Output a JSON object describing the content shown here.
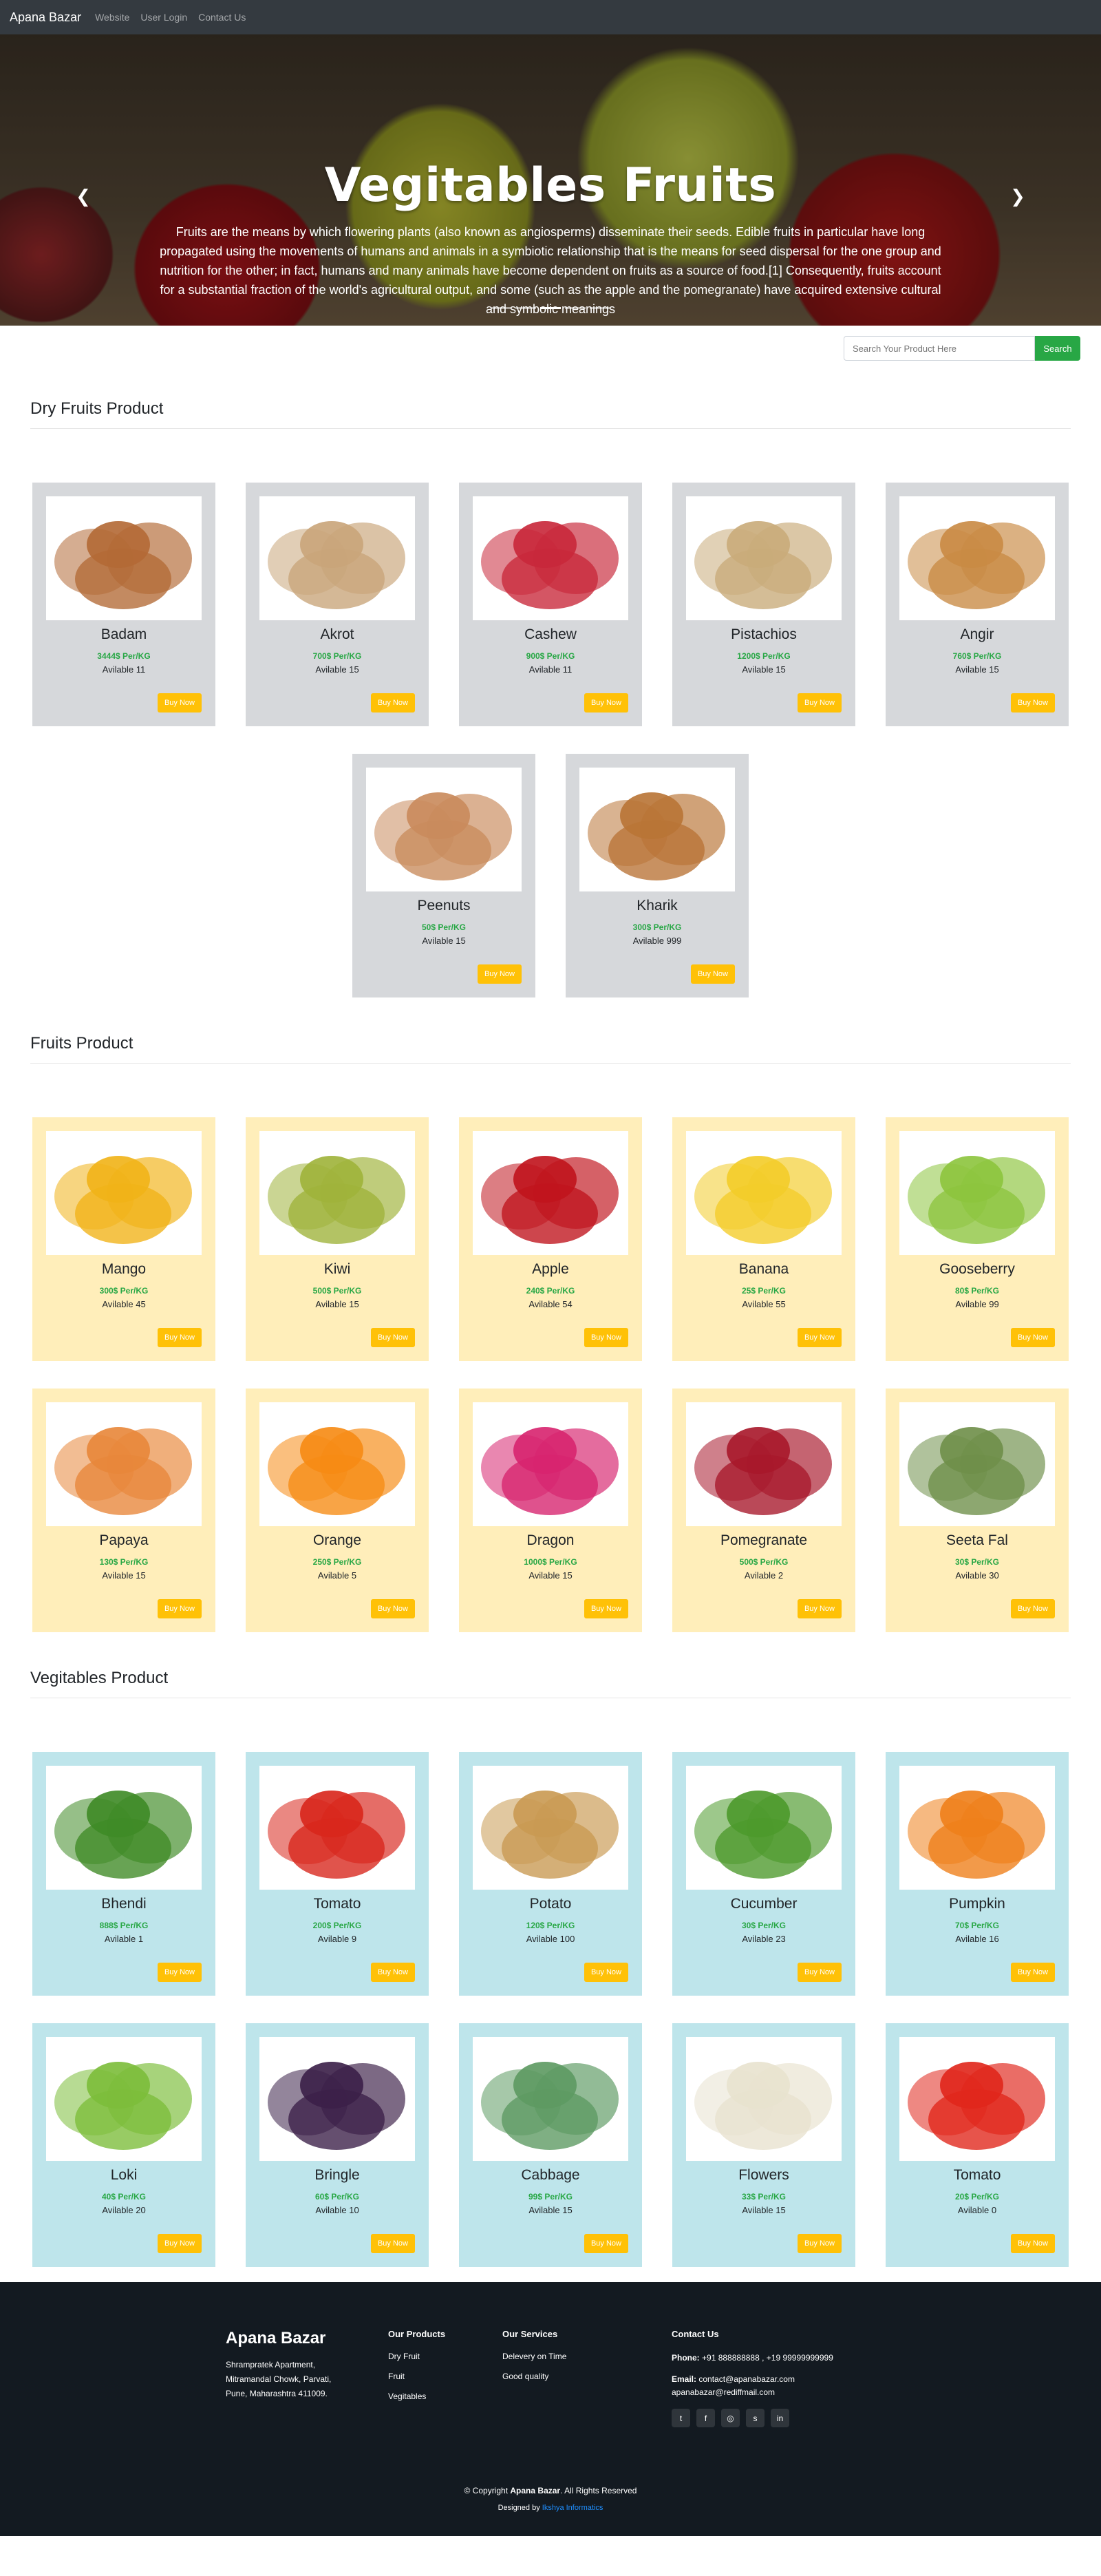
{
  "navbar": {
    "brand": "Apana Bazar",
    "links": [
      "Website",
      "User Login",
      "Contact Us"
    ]
  },
  "hero": {
    "title": "Vegitables Fruits",
    "text": "Fruits are the means by which flowering plants (also known as angiosperms) disseminate their seeds. Edible fruits in particular have long propagated using the movements of humans and animals in a symbiotic relationship that is the means for seed dispersal for the one group and nutrition for the other; in fact, humans and many animals have become dependent on fruits as a source of food.[1] Consequently, fruits account for a substantial fraction of the world's agricultural output, and some (such as the apple and the pomegranate) have acquired extensive cultural and symbolic meanings",
    "prev_icon": "chevron-left-icon",
    "next_icon": "chevron-right-icon",
    "active_slide": 3,
    "slide_count": 5
  },
  "search": {
    "placeholder": "Search Your Product Here",
    "button": "Search"
  },
  "buy_label": "Buy Now",
  "sections": [
    {
      "title": "Dry Fruits Product",
      "products": [
        {
          "name": "Badam",
          "price": "3444$ Per/KG",
          "avail": "Avilable 11",
          "color": "#b36a36"
        },
        {
          "name": "Akrot",
          "price": "700$ Per/KG",
          "avail": "Avilable 15",
          "color": "#c9a57a"
        },
        {
          "name": "Cashew",
          "price": "900$ Per/KG",
          "avail": "Avilable 11",
          "color": "#c8283a"
        },
        {
          "name": "Pistachios",
          "price": "1200$ Per/KG",
          "avail": "Avilable 15",
          "color": "#c9ab7a"
        },
        {
          "name": "Angir",
          "price": "760$ Per/KG",
          "avail": "Avilable 15",
          "color": "#c98a44"
        },
        {
          "name": "Peenuts",
          "price": "50$ Per/KG",
          "avail": "Avilable 15",
          "color": "#c98b5c"
        },
        {
          "name": "Kharik",
          "price": "300$ Per/KG",
          "avail": "Avilable 999",
          "color": "#b97436"
        }
      ]
    },
    {
      "title": "Fruits Product",
      "products": [
        {
          "name": "Mango",
          "price": "300$ Per/KG",
          "avail": "Avilable 45",
          "color": "#f1b318"
        },
        {
          "name": "Kiwi",
          "price": "500$ Per/KG",
          "avail": "Avilable 15",
          "color": "#9fb33a"
        },
        {
          "name": "Apple",
          "price": "240$ Per/KG",
          "avail": "Avilable 54",
          "color": "#c0141d"
        },
        {
          "name": "Banana",
          "price": "25$ Per/KG",
          "avail": "Avilable 55",
          "color": "#f3cc2a"
        },
        {
          "name": "Gooseberry",
          "price": "80$ Per/KG",
          "avail": "Avilable 99",
          "color": "#8dc53e"
        },
        {
          "name": "Papaya",
          "price": "130$ Per/KG",
          "avail": "Avilable 15",
          "color": "#e8873a"
        },
        {
          "name": "Orange",
          "price": "250$ Per/KG",
          "avail": "Avilable 5",
          "color": "#f68b14"
        },
        {
          "name": "Dragon",
          "price": "1000$ Per/KG",
          "avail": "Avilable 15",
          "color": "#d7246f"
        },
        {
          "name": "Pomegranate",
          "price": "500$ Per/KG",
          "avail": "Avilable 2",
          "color": "#a8182b"
        },
        {
          "name": "Seeta Fal",
          "price": "30$ Per/KG",
          "avail": "Avilable 30",
          "color": "#6f8f4a"
        }
      ]
    },
    {
      "title": "Vegitables Product",
      "products": [
        {
          "name": "Bhendi",
          "price": "888$ Per/KG",
          "avail": "Avilable 1",
          "color": "#3f8a26"
        },
        {
          "name": "Tomato",
          "price": "200$ Per/KG",
          "avail": "Avilable 9",
          "color": "#d8261c"
        },
        {
          "name": "Potato",
          "price": "120$ Per/KG",
          "avail": "Avilable 100",
          "color": "#c99a52"
        },
        {
          "name": "Cucumber",
          "price": "30$ Per/KG",
          "avail": "Avilable 23",
          "color": "#4d9a2c"
        },
        {
          "name": "Pumpkin",
          "price": "70$ Per/KG",
          "avail": "Avilable 16",
          "color": "#ef7f1a"
        },
        {
          "name": "Loki",
          "price": "40$ Per/KG",
          "avail": "Avilable 20",
          "color": "#7cbd3a"
        },
        {
          "name": "Bringle",
          "price": "60$ Per/KG",
          "avail": "Avilable 10",
          "color": "#3b2048"
        },
        {
          "name": "Cabbage",
          "price": "99$ Per/KG",
          "avail": "Avilable 15",
          "color": "#5d9a62"
        },
        {
          "name": "Flowers",
          "price": "33$ Per/KG",
          "avail": "Avilable 15",
          "color": "#e8e2cf"
        },
        {
          "name": "Tomato",
          "price": "20$ Per/KG",
          "avail": "Avilable 0",
          "color": "#e0261b"
        }
      ]
    }
  ],
  "footer": {
    "brand": "Apana Bazar",
    "address": [
      "Shrampratek Apartment,",
      "Mitramandal Chowk, Parvati,",
      "Pune, Maharashtra 411009."
    ],
    "products_title": "Our Products",
    "products": [
      "Dry Fruit",
      "Fruit",
      "Vegitables"
    ],
    "services_title": "Our Services",
    "services": [
      "Delevery on Time",
      "Good quality"
    ],
    "contact_title": "Contact Us",
    "phone_label": "Phone:",
    "phone": "+91 888888888 , +19 99999999999",
    "email_label": "Email:",
    "email": "contact@apanabazar.com",
    "email2": "apanabazar@rediffmail.com",
    "social": [
      {
        "icon": "twitter-icon",
        "glyph": "t"
      },
      {
        "icon": "facebook-icon",
        "glyph": "f"
      },
      {
        "icon": "instagram-icon",
        "glyph": "◎"
      },
      {
        "icon": "skype-icon",
        "glyph": "s"
      },
      {
        "icon": "linkedin-icon",
        "glyph": "in"
      }
    ],
    "copyright_pre": "© Copyright",
    "copyright_brand": "Apana Bazar",
    "copyright_post": ". All Rights Reserved",
    "designed_by": "Designed by",
    "designer": "Ikshya Informatics"
  }
}
